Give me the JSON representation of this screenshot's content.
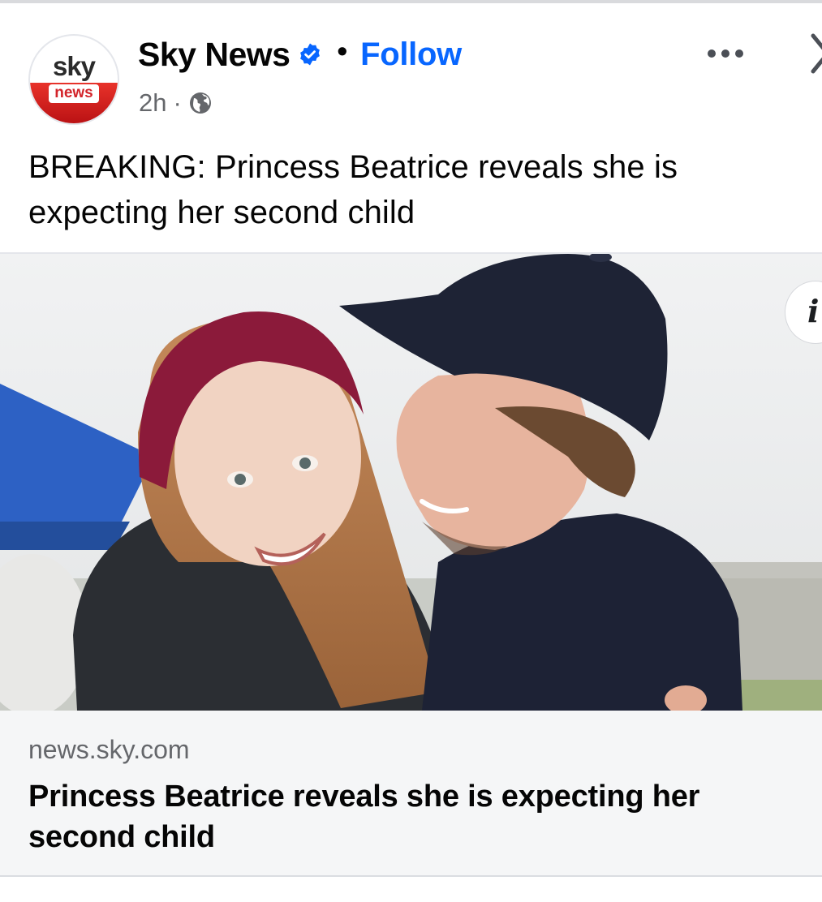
{
  "post": {
    "page_name": "Sky News",
    "dot": "•",
    "follow_label": "Follow",
    "time": "2h",
    "meta_sep": "·",
    "caption": "BREAKING: Princess Beatrice reveals she is expecting her second child"
  },
  "avatar": {
    "logo_top": "sky",
    "logo_bottom": "news"
  },
  "link": {
    "domain": "news.sky.com",
    "title": "Princess Beatrice reveals she is expecting her second child"
  },
  "media": {
    "info_glyph": "i"
  },
  "icons": {
    "verified": "verified-badge-icon",
    "globe": "globe-icon",
    "more": "more-options-icon",
    "close": "close-icon",
    "info": "info-icon"
  },
  "colors": {
    "follow": "#0866ff",
    "verified": "#0866ff",
    "secondary_text": "#65676b",
    "brand_red": "#d3242a"
  }
}
